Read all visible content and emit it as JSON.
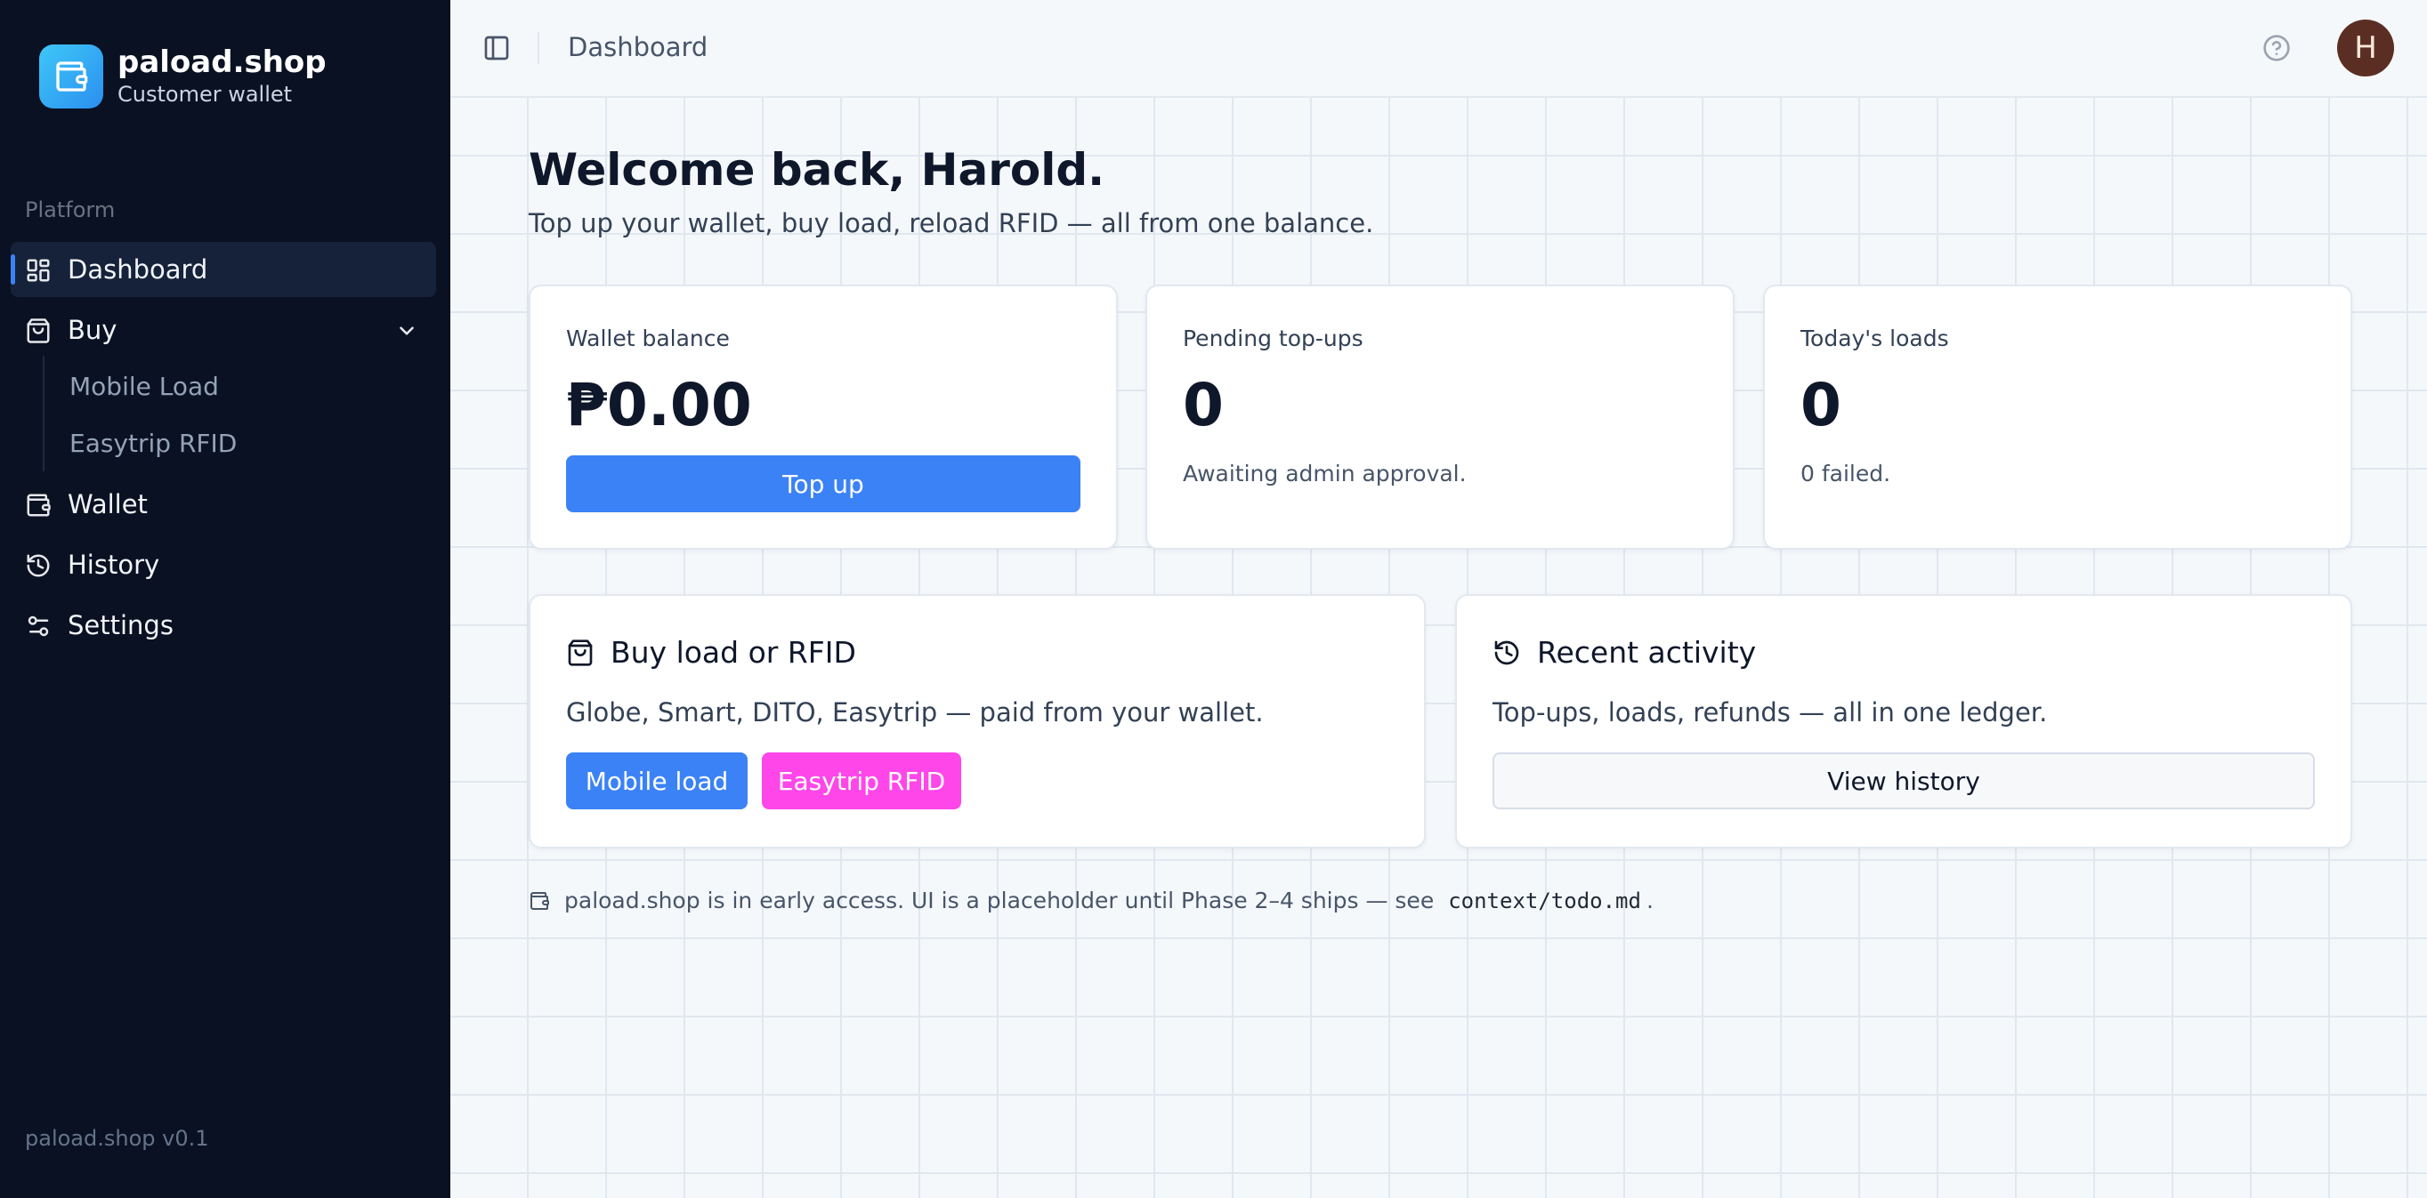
{
  "sidebar": {
    "brand_name": "paload.shop",
    "brand_subtitle": "Customer wallet",
    "section_label": "Platform",
    "items": {
      "dashboard": "Dashboard",
      "buy": "Buy",
      "mobile_load": "Mobile Load",
      "easytrip_rfid": "Easytrip RFID",
      "wallet": "Wallet",
      "history": "History",
      "settings": "Settings"
    },
    "version": "paload.shop v0.1"
  },
  "header": {
    "breadcrumb": "Dashboard",
    "avatar_initial": "H"
  },
  "main": {
    "welcome_title": "Welcome back, Harold.",
    "welcome_subtitle": "Top up your wallet, buy load, reload RFID — all from one balance.",
    "stats": {
      "wallet": {
        "label": "Wallet balance",
        "value": "₱0.00",
        "button": "Top up"
      },
      "pending": {
        "label": "Pending top-ups",
        "value": "0",
        "note": "Awaiting admin approval."
      },
      "today": {
        "label": "Today's loads",
        "value": "0",
        "note": "0 failed."
      }
    },
    "buy_card": {
      "title": "Buy load or RFID",
      "description": "Globe, Smart, DITO, Easytrip — paid from your wallet.",
      "mobile_button": "Mobile load",
      "rfid_button": "Easytrip RFID"
    },
    "activity_card": {
      "title": "Recent activity",
      "description": "Top-ups, loads, refunds — all in one ledger.",
      "button": "View history"
    },
    "notice": {
      "text": "paload.shop is in early access. UI is a placeholder until Phase 2–4 ships — see",
      "code": "context/todo.md",
      "end": "."
    }
  },
  "colors": {
    "sidebar_bg": "#0a1122",
    "accent_blue": "#3b82f6",
    "accent_pink": "#ff46e9",
    "avatar_bg": "#5a2e22"
  },
  "icons": {
    "brand": "wallet-icon",
    "dashboard": "layout-grid-icon",
    "buy": "shopping-bag-icon",
    "wallet": "wallet-icon",
    "history": "history-icon",
    "settings": "sliders-icon",
    "panel": "panel-left-icon",
    "help": "help-circle-icon"
  }
}
